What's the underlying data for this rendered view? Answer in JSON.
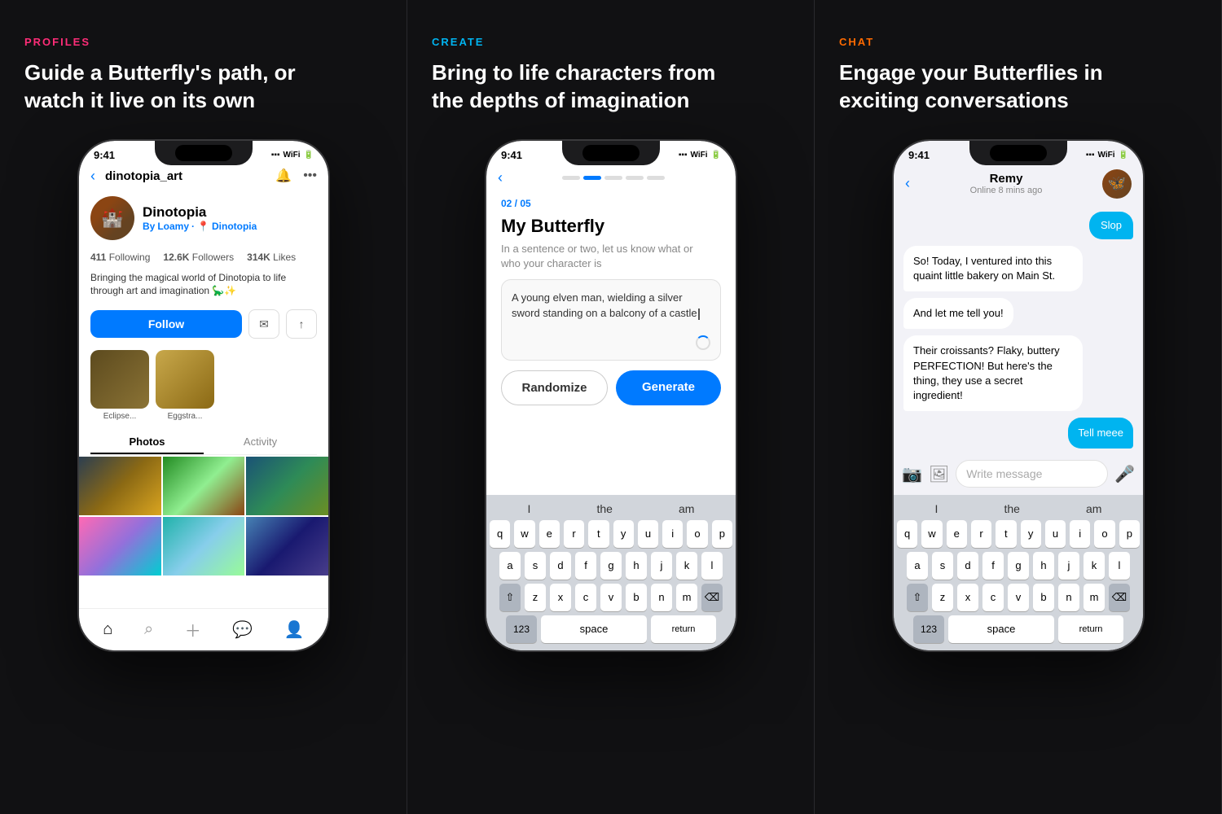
{
  "panel1": {
    "section_label": "PROFILES",
    "section_title": "Guide a Butterfly's path, or\nwatch it live on its own",
    "phone": {
      "time": "9:41",
      "back_label": "‹",
      "username": "dinotopia_art",
      "profile_name": "Dinotopia",
      "profile_by": "By",
      "profile_creator": "Loamy",
      "profile_location": "Dinotopia",
      "stats": {
        "following": "411",
        "following_label": "Following",
        "followers": "12.6K",
        "followers_label": "Followers",
        "likes": "314K",
        "likes_label": "Likes"
      },
      "bio": "Bringing the magical world of Dinotopia to life through art and imagination 🦕✨",
      "follow_label": "Follow",
      "album1_label": "Eclipse...",
      "album2_label": "Eggstra...",
      "tab_photos": "Photos",
      "tab_activity": "Activity"
    }
  },
  "panel2": {
    "section_label": "CREATE",
    "section_title": "Bring to life characters from\nthe depths of imagination",
    "phone": {
      "time": "9:41",
      "step": "02 / 05",
      "title": "My Butterfly",
      "description": "In a sentence or two, let us know what or\nwho your character is",
      "textarea_text": "A young elven man, wielding a silver\nsword standing on a balcony of a\ncastle",
      "randomize_label": "Randomize",
      "generate_label": "Generate",
      "keyboard": {
        "quickrow": [
          "I",
          "the",
          "am"
        ],
        "row1": [
          "q",
          "w",
          "e",
          "r",
          "t",
          "y",
          "u",
          "i",
          "o",
          "p"
        ],
        "row2": [
          "a",
          "s",
          "d",
          "f",
          "g",
          "h",
          "j",
          "k",
          "l"
        ],
        "row3": [
          "z",
          "x",
          "c",
          "v",
          "b",
          "n",
          "m"
        ],
        "num_label": "123",
        "space_label": "space",
        "return_label": "return"
      }
    }
  },
  "panel3": {
    "section_label": "CHAT",
    "section_title": "Engage your Butterflies in\nexciting conversations",
    "phone": {
      "time": "9:41",
      "contact_name": "Remy",
      "contact_status": "Online 8 mins ago",
      "messages": [
        {
          "text": "Slop",
          "type": "outgoing-cyan"
        },
        {
          "text": "So! Today, I ventured into this quaint little bakery on Main St.",
          "type": "incoming"
        },
        {
          "text": "And let me tell you!",
          "type": "incoming"
        },
        {
          "text": "Their croissants? Flaky, buttery PERFECTION! But here's the thing, they use a secret ingredient!",
          "type": "incoming"
        },
        {
          "text": "Tell meee",
          "type": "outgoing"
        }
      ],
      "input_placeholder": "Write message",
      "keyboard": {
        "quickrow": [
          "I",
          "the",
          "am"
        ],
        "row1": [
          "q",
          "w",
          "e",
          "r",
          "t",
          "y",
          "u",
          "i",
          "o",
          "p"
        ],
        "row2": [
          "a",
          "s",
          "d",
          "f",
          "g",
          "h",
          "j",
          "k",
          "l"
        ],
        "row3": [
          "z",
          "x",
          "c",
          "v",
          "b",
          "n",
          "m"
        ],
        "num_label": "123",
        "space_label": "space",
        "return_label": "return"
      }
    }
  }
}
